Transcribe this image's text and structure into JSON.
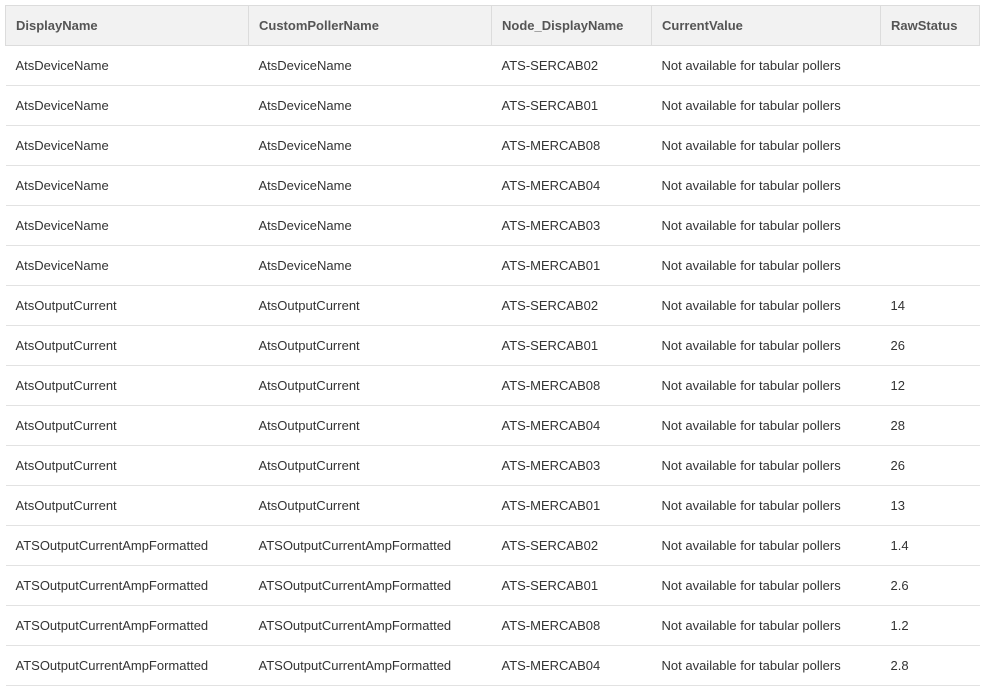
{
  "table": {
    "columns": [
      "DisplayName",
      "CustomPollerName",
      "Node_DisplayName",
      "CurrentValue",
      "RawStatus"
    ],
    "rows": [
      [
        "AtsDeviceName",
        "AtsDeviceName",
        "ATS-SERCAB02",
        "Not available for tabular pollers",
        ""
      ],
      [
        "AtsDeviceName",
        "AtsDeviceName",
        "ATS-SERCAB01",
        "Not available for tabular pollers",
        ""
      ],
      [
        "AtsDeviceName",
        "AtsDeviceName",
        "ATS-MERCAB08",
        "Not available for tabular pollers",
        ""
      ],
      [
        "AtsDeviceName",
        "AtsDeviceName",
        "ATS-MERCAB04",
        "Not available for tabular pollers",
        ""
      ],
      [
        "AtsDeviceName",
        "AtsDeviceName",
        "ATS-MERCAB03",
        "Not available for tabular pollers",
        ""
      ],
      [
        "AtsDeviceName",
        "AtsDeviceName",
        "ATS-MERCAB01",
        "Not available for tabular pollers",
        ""
      ],
      [
        "AtsOutputCurrent",
        "AtsOutputCurrent",
        "ATS-SERCAB02",
        "Not available for tabular pollers",
        "14"
      ],
      [
        "AtsOutputCurrent",
        "AtsOutputCurrent",
        "ATS-SERCAB01",
        "Not available for tabular pollers",
        "26"
      ],
      [
        "AtsOutputCurrent",
        "AtsOutputCurrent",
        "ATS-MERCAB08",
        "Not available for tabular pollers",
        "12"
      ],
      [
        "AtsOutputCurrent",
        "AtsOutputCurrent",
        "ATS-MERCAB04",
        "Not available for tabular pollers",
        "28"
      ],
      [
        "AtsOutputCurrent",
        "AtsOutputCurrent",
        "ATS-MERCAB03",
        "Not available for tabular pollers",
        "26"
      ],
      [
        "AtsOutputCurrent",
        "AtsOutputCurrent",
        "ATS-MERCAB01",
        "Not available for tabular pollers",
        "13"
      ],
      [
        "ATSOutputCurrentAmpFormatted",
        "ATSOutputCurrentAmpFormatted",
        "ATS-SERCAB02",
        "Not available for tabular pollers",
        "1.4"
      ],
      [
        "ATSOutputCurrentAmpFormatted",
        "ATSOutputCurrentAmpFormatted",
        "ATS-SERCAB01",
        "Not available for tabular pollers",
        "2.6"
      ],
      [
        "ATSOutputCurrentAmpFormatted",
        "ATSOutputCurrentAmpFormatted",
        "ATS-MERCAB08",
        "Not available for tabular pollers",
        "1.2"
      ],
      [
        "ATSOutputCurrentAmpFormatted",
        "ATSOutputCurrentAmpFormatted",
        "ATS-MERCAB04",
        "Not available for tabular pollers",
        "2.8"
      ]
    ]
  }
}
